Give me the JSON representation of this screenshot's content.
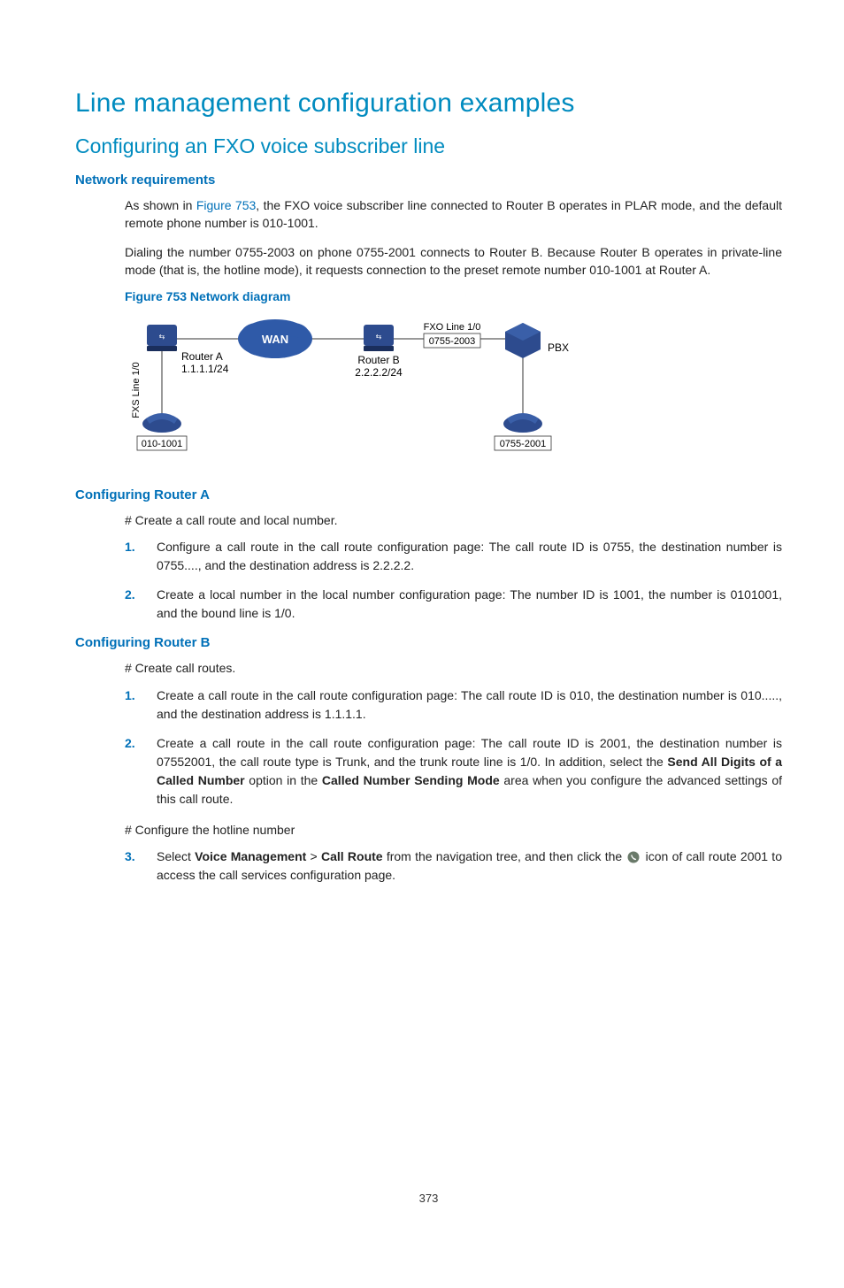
{
  "h1": "Line management configuration examples",
  "h2": "Configuring an FXO voice subscriber line",
  "sections": {
    "net_req": {
      "title": "Network requirements",
      "p1_a": "As shown in ",
      "p1_link": "Figure 753",
      "p1_b": ", the FXO voice subscriber line connected to Router B operates in PLAR mode, and the default remote phone number is 010-1001.",
      "p2": "Dialing the number 0755-2003 on phone 0755-2001 connects to Router B. Because Router B operates in private-line mode (that is, the hotline mode), it requests connection to the preset remote number 010-1001 at Router A.",
      "fig_label": "Figure 753 Network diagram",
      "diagram": {
        "routerA": {
          "label": "Router A",
          "ip": "1.1.1.1/24",
          "phone": "010-1001",
          "line_label": "FXS Line 1/0"
        },
        "routerB": {
          "label": "Router B",
          "ip": "2.2.2.2/24",
          "fxo_label": "FXO Line 1/0",
          "fxo_num": "0755-2003"
        },
        "wan_label": "WAN",
        "pbx_label": "PBX",
        "phone_right": "0755-2001"
      }
    },
    "cfg_a": {
      "title": "Configuring Router A",
      "hash": "# Create a call route and local number.",
      "steps": [
        "Configure a call route in the call route configuration page: The call route ID is 0755, the destination number is 0755...., and the destination address is 2.2.2.2.",
        "Create a local number in the local number configuration page: The number ID is 1001, the number is 0101001, and the bound line is 1/0."
      ]
    },
    "cfg_b": {
      "title": "Configuring Router B",
      "hash1": "# Create call routes.",
      "step1": "Create a call route in the call route configuration page: The call route ID is 010, the destination number is 010....., and the destination address is 1.1.1.1.",
      "step2_a": "Create a call route in the call route configuration page: The call route ID is 2001, the destination number is 07552001, the call route type is Trunk, and the trunk route line is 1/0. In addition, select the ",
      "step2_bold1": "Send All Digits of a Called Number",
      "step2_b": " option in the ",
      "step2_bold2": "Called Number Sending Mode",
      "step2_c": " area when you configure the advanced settings of this call route.",
      "hash2": "# Configure the hotline number",
      "step3_a": "Select ",
      "step3_bold1": "Voice Management",
      "step3_gt": " > ",
      "step3_bold2": "Call Route",
      "step3_b": " from the navigation tree, and then click the ",
      "step3_icon_name": "call-services-icon",
      "step3_c": " icon of call route 2001 to access the call services configuration page."
    }
  },
  "page_number": "373"
}
